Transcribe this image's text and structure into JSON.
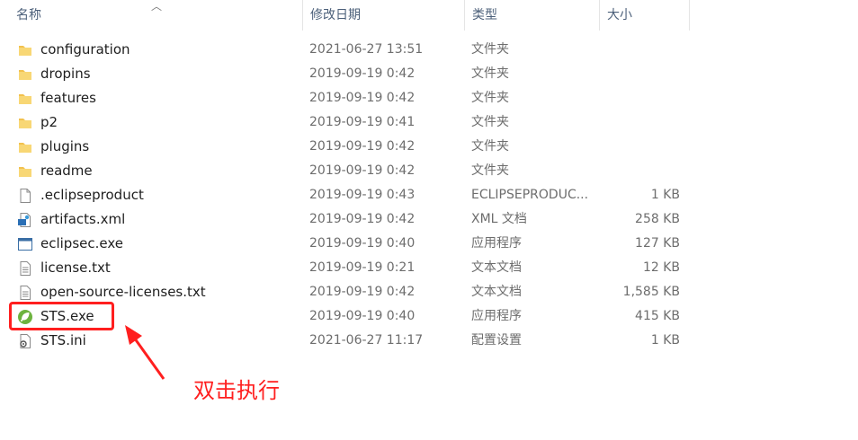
{
  "columns": {
    "name": "名称",
    "date": "修改日期",
    "type": "类型",
    "size": "大小"
  },
  "files": [
    {
      "name": "configuration",
      "date": "2021-06-27 13:51",
      "type": "文件夹",
      "size": "",
      "icon": "folder-icon"
    },
    {
      "name": "dropins",
      "date": "2019-09-19 0:42",
      "type": "文件夹",
      "size": "",
      "icon": "folder-icon"
    },
    {
      "name": "features",
      "date": "2019-09-19 0:42",
      "type": "文件夹",
      "size": "",
      "icon": "folder-icon"
    },
    {
      "name": "p2",
      "date": "2019-09-19 0:41",
      "type": "文件夹",
      "size": "",
      "icon": "folder-icon"
    },
    {
      "name": "plugins",
      "date": "2019-09-19 0:42",
      "type": "文件夹",
      "size": "",
      "icon": "folder-icon"
    },
    {
      "name": "readme",
      "date": "2019-09-19 0:42",
      "type": "文件夹",
      "size": "",
      "icon": "folder-icon"
    },
    {
      "name": ".eclipseproduct",
      "date": "2019-09-19 0:43",
      "type": "ECLIPSEPRODUC...",
      "size": "1 KB",
      "icon": "blank-file-icon"
    },
    {
      "name": "artifacts.xml",
      "date": "2019-09-19 0:42",
      "type": "XML 文档",
      "size": "258 KB",
      "icon": "xml-file-icon"
    },
    {
      "name": "eclipsec.exe",
      "date": "2019-09-19 0:40",
      "type": "应用程序",
      "size": "127 KB",
      "icon": "exe-window-icon"
    },
    {
      "name": "license.txt",
      "date": "2019-09-19 0:21",
      "type": "文本文档",
      "size": "12 KB",
      "icon": "text-file-icon"
    },
    {
      "name": "open-source-licenses.txt",
      "date": "2019-09-19 0:42",
      "type": "文本文档",
      "size": "1,585 KB",
      "icon": "text-file-icon"
    },
    {
      "name": "STS.exe",
      "date": "2019-09-19 0:40",
      "type": "应用程序",
      "size": "415 KB",
      "icon": "spring-leaf-icon"
    },
    {
      "name": "STS.ini",
      "date": "2021-06-27 11:17",
      "type": "配置设置",
      "size": "1 KB",
      "icon": "settings-file-icon"
    }
  ],
  "annotation": {
    "text": "双击执行",
    "color": "#ff1f1f"
  },
  "colors": {
    "folder": "#f2c14e",
    "spring": "#6db33f"
  }
}
